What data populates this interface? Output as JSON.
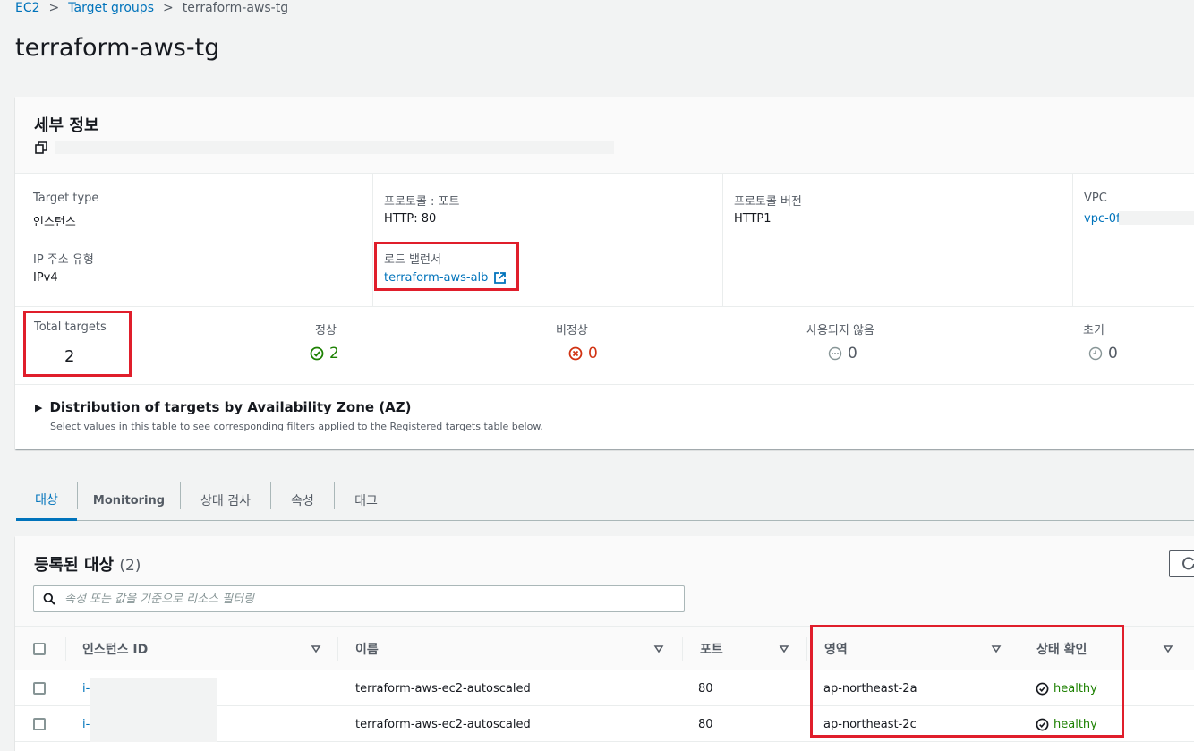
{
  "breadcrumb": {
    "items": [
      "EC2",
      "Target groups"
    ],
    "current": "terraform-aws-tg"
  },
  "page_title": "terraform-aws-tg",
  "details": {
    "title": "세부 정보",
    "fields": {
      "target_type": {
        "label": "Target type",
        "value": "인스턴스"
      },
      "ip_type": {
        "label": "IP 주소 유형",
        "value": "IPv4"
      },
      "protocol_port": {
        "label": "프로토콜 : 포트",
        "value": "HTTP: 80"
      },
      "load_balancer": {
        "label": "로드 밸런서",
        "value": "terraform-aws-alb"
      },
      "protocol_version": {
        "label": "프로토콜 버전",
        "value": "HTTP1"
      },
      "vpc": {
        "label": "VPC",
        "value": "vpc-0f"
      }
    },
    "stats": {
      "total": {
        "label": "Total targets",
        "value": "2"
      },
      "healthy": {
        "label": "정상",
        "value": "2"
      },
      "unhealthy": {
        "label": "비정상",
        "value": "0"
      },
      "unused": {
        "label": "사용되지 않음",
        "value": "0"
      },
      "initial": {
        "label": "초기",
        "value": "0"
      }
    },
    "distribution": {
      "title": "Distribution of targets by Availability Zone (AZ)",
      "description": "Select values in this table to see corresponding filters applied to the Registered targets table below."
    }
  },
  "tabs": [
    "대상",
    "Monitoring",
    "상태 검사",
    "속성",
    "태그"
  ],
  "targets": {
    "title": "등록된 대상",
    "count": "(2)",
    "search_placeholder": "속성 또는 값을 기준으로 리소스 필터링",
    "columns": [
      "인스턴스 ID",
      "이름",
      "포트",
      "영역",
      "상태 확인"
    ],
    "rows": [
      {
        "id": "i-",
        "name": "terraform-aws-ec2-autoscaled",
        "port": "80",
        "zone": "ap-northeast-2a",
        "health": "healthy"
      },
      {
        "id": "i-",
        "name": "terraform-aws-ec2-autoscaled",
        "port": "80",
        "zone": "ap-northeast-2c",
        "health": "healthy"
      }
    ]
  },
  "colors": {
    "link": "#0073bb",
    "ok": "#1d8102",
    "error": "#d13212",
    "highlight": "#e01e2b"
  }
}
